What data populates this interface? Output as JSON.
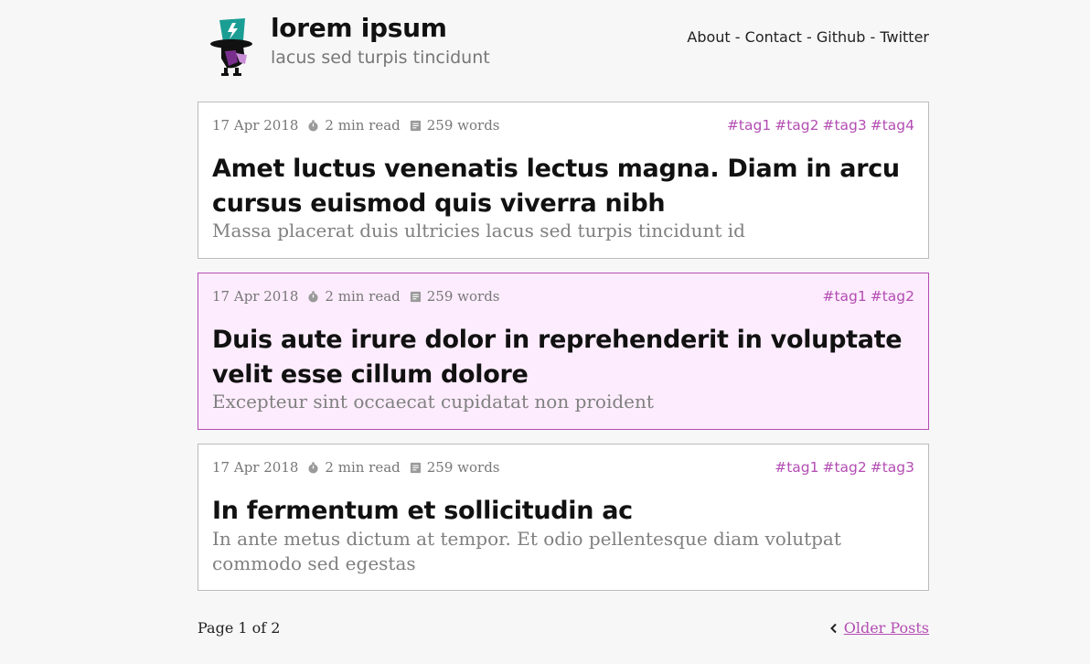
{
  "site": {
    "title": "lorem ipsum",
    "subtitle": "lacus sed turpis tincidunt"
  },
  "nav": {
    "about": "About",
    "contact": "Contact",
    "github": "Github",
    "twitter": "Twitter",
    "separator": " - "
  },
  "posts": [
    {
      "date": "17 Apr 2018",
      "read_time": "2 min read",
      "words": "259 words",
      "tags": [
        "#tag1",
        "#tag2",
        "#tag3",
        "#tag4"
      ],
      "title": "Amet luctus venenatis lectus magna. Diam in arcu cursus euismod quis viverra nibh",
      "summary": "Massa placerat duis ultricies lacus sed turpis tincidunt id"
    },
    {
      "date": "17 Apr 2018",
      "read_time": "2 min read",
      "words": "259 words",
      "tags": [
        "#tag1",
        "#tag2"
      ],
      "title": "Duis aute irure dolor in reprehenderit in voluptate velit esse cillum dolore",
      "summary": "Excepteur sint occaecat cupidatat non proident"
    },
    {
      "date": "17 Apr 2018",
      "read_time": "2 min read",
      "words": "259 words",
      "tags": [
        "#tag1",
        "#tag2",
        "#tag3"
      ],
      "title": "In fermentum et sollicitudin ac",
      "summary": "In ante metus dictum at tempor. Et odio pellentesque diam volutpat commodo sed egestas"
    }
  ],
  "pagination": {
    "page_label": "Page 1 of 2",
    "older_label": "Older Posts"
  },
  "colors": {
    "accent": "#b34db3",
    "highlight_bg": "#fdecfd",
    "logo_teal": "#1a9e94",
    "logo_purple": "#7a2f8f"
  },
  "icons": {
    "timer": "stopwatch-icon",
    "words": "document-icon",
    "prev": "chevron-left-icon",
    "logo": "top-hat-mascot-logo"
  }
}
